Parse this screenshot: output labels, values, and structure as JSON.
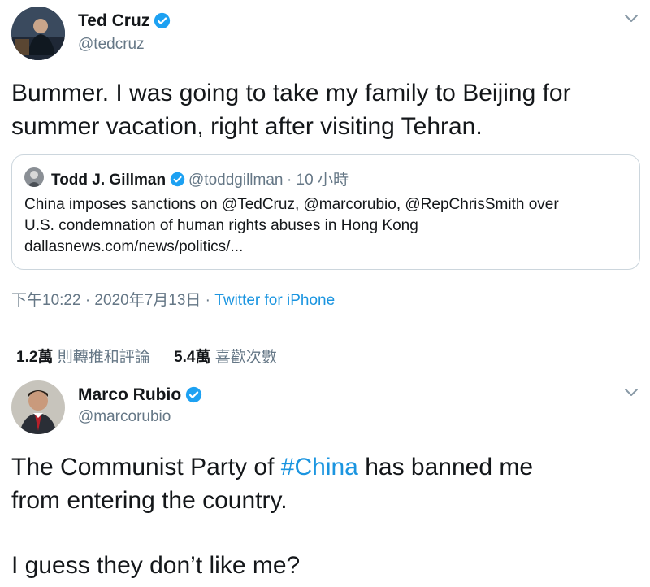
{
  "tweet1": {
    "name": "Ted Cruz",
    "handle": "@tedcruz",
    "text_line1": "Bummer. I was going to take my family to Beijing for",
    "text_line2": "summer vacation, right after visiting Tehran.",
    "quote": {
      "name": "Todd J. Gillman",
      "handle": "@toddgillman",
      "time": "· 10 小時",
      "line1": "China imposes sanctions on @TedCruz, @marcorubio, @RepChrisSmith over",
      "line2": "U.S. condemnation of human rights abuses in Hong Kong",
      "line3": "dallasnews.com/news/politics/..."
    },
    "timestamp": "下午10:22 · 2020年7月13日 ·",
    "source": "Twitter for iPhone",
    "stats": {
      "retweets_count": "1.2萬",
      "retweets_label": "則轉推和評論",
      "likes_count": "5.4萬",
      "likes_label": "喜歡次數"
    }
  },
  "tweet2": {
    "name": "Marco Rubio",
    "handle": "@marcorubio",
    "text_pre": "The Communist Party of ",
    "hashtag": "#China",
    "text_post": " has banned me",
    "text_line2": "from entering the country.",
    "text_line3": "I guess they don’t like me?"
  },
  "colors": {
    "verified": "#1da1f2",
    "link": "#1b95e0",
    "secondary_text": "#657786"
  },
  "icons": {
    "verified": "verified-badge-icon",
    "menu": "chevron-down-icon"
  }
}
